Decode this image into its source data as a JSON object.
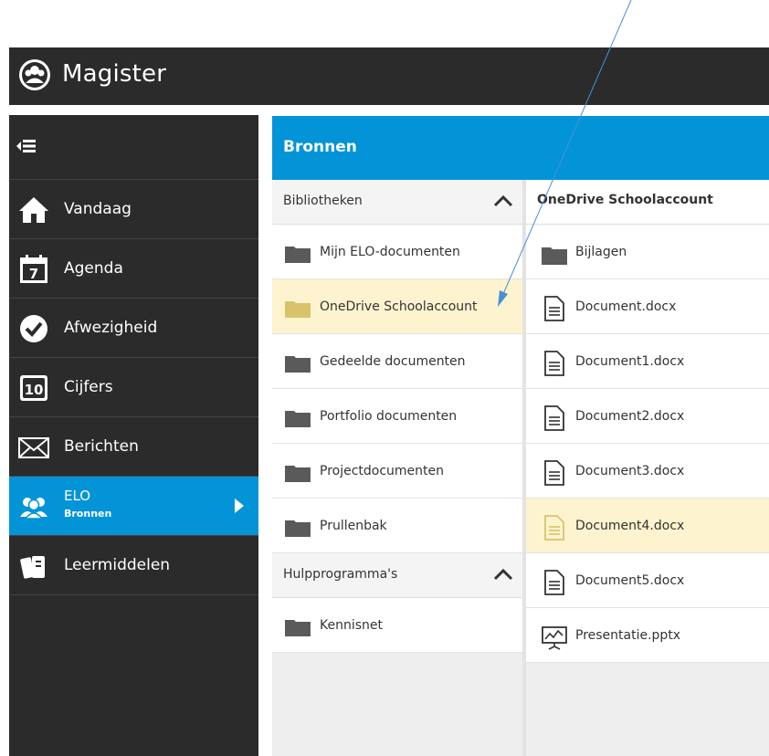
{
  "app": {
    "title": "Magister"
  },
  "sidebar": {
    "items": [
      {
        "label": "Vandaag",
        "icon": "home-icon"
      },
      {
        "label": "Agenda",
        "icon": "calendar-icon",
        "icon_text": "7"
      },
      {
        "label": "Afwezigheid",
        "icon": "check-circle-icon"
      },
      {
        "label": "Cijfers",
        "icon": "grades-icon",
        "icon_text": "10"
      },
      {
        "label": "Berichten",
        "icon": "envelope-icon"
      },
      {
        "label": "ELO",
        "sub": "Bronnen",
        "icon": "users-icon",
        "active": true
      },
      {
        "label": "Leermiddelen",
        "icon": "books-icon"
      }
    ]
  },
  "main": {
    "header": "Bronnen",
    "libraries": {
      "title": "Bibliotheken",
      "items": [
        "Mijn ELO-documenten",
        "OneDrive Schoolaccount",
        "Gedeelde documenten",
        "Portfolio documenten",
        "Projectdocumenten",
        "Prullenbak"
      ],
      "selected": "OneDrive Schoolaccount"
    },
    "tools": {
      "title": "Hulpprogramma's",
      "items": [
        "Kennisnet"
      ]
    },
    "files": {
      "title": "OneDrive Schoolaccount",
      "items": [
        {
          "name": "Bijlagen",
          "type": "folder"
        },
        {
          "name": "Document.docx",
          "type": "doc"
        },
        {
          "name": "Document1.docx",
          "type": "doc"
        },
        {
          "name": "Document2.docx",
          "type": "doc"
        },
        {
          "name": "Document3.docx",
          "type": "doc"
        },
        {
          "name": "Document4.docx",
          "type": "doc",
          "selected": true
        },
        {
          "name": "Document5.docx",
          "type": "doc"
        },
        {
          "name": "Presentatie.pptx",
          "type": "presentation"
        }
      ]
    }
  },
  "colors": {
    "dark": "#2b2b2b",
    "accent": "#0394d8",
    "selected_row": "#fdf3cf",
    "folder_gray": "#5a5a5a",
    "folder_yellow": "#d9c36a",
    "annotation_arrow": "#4a8fd6"
  }
}
